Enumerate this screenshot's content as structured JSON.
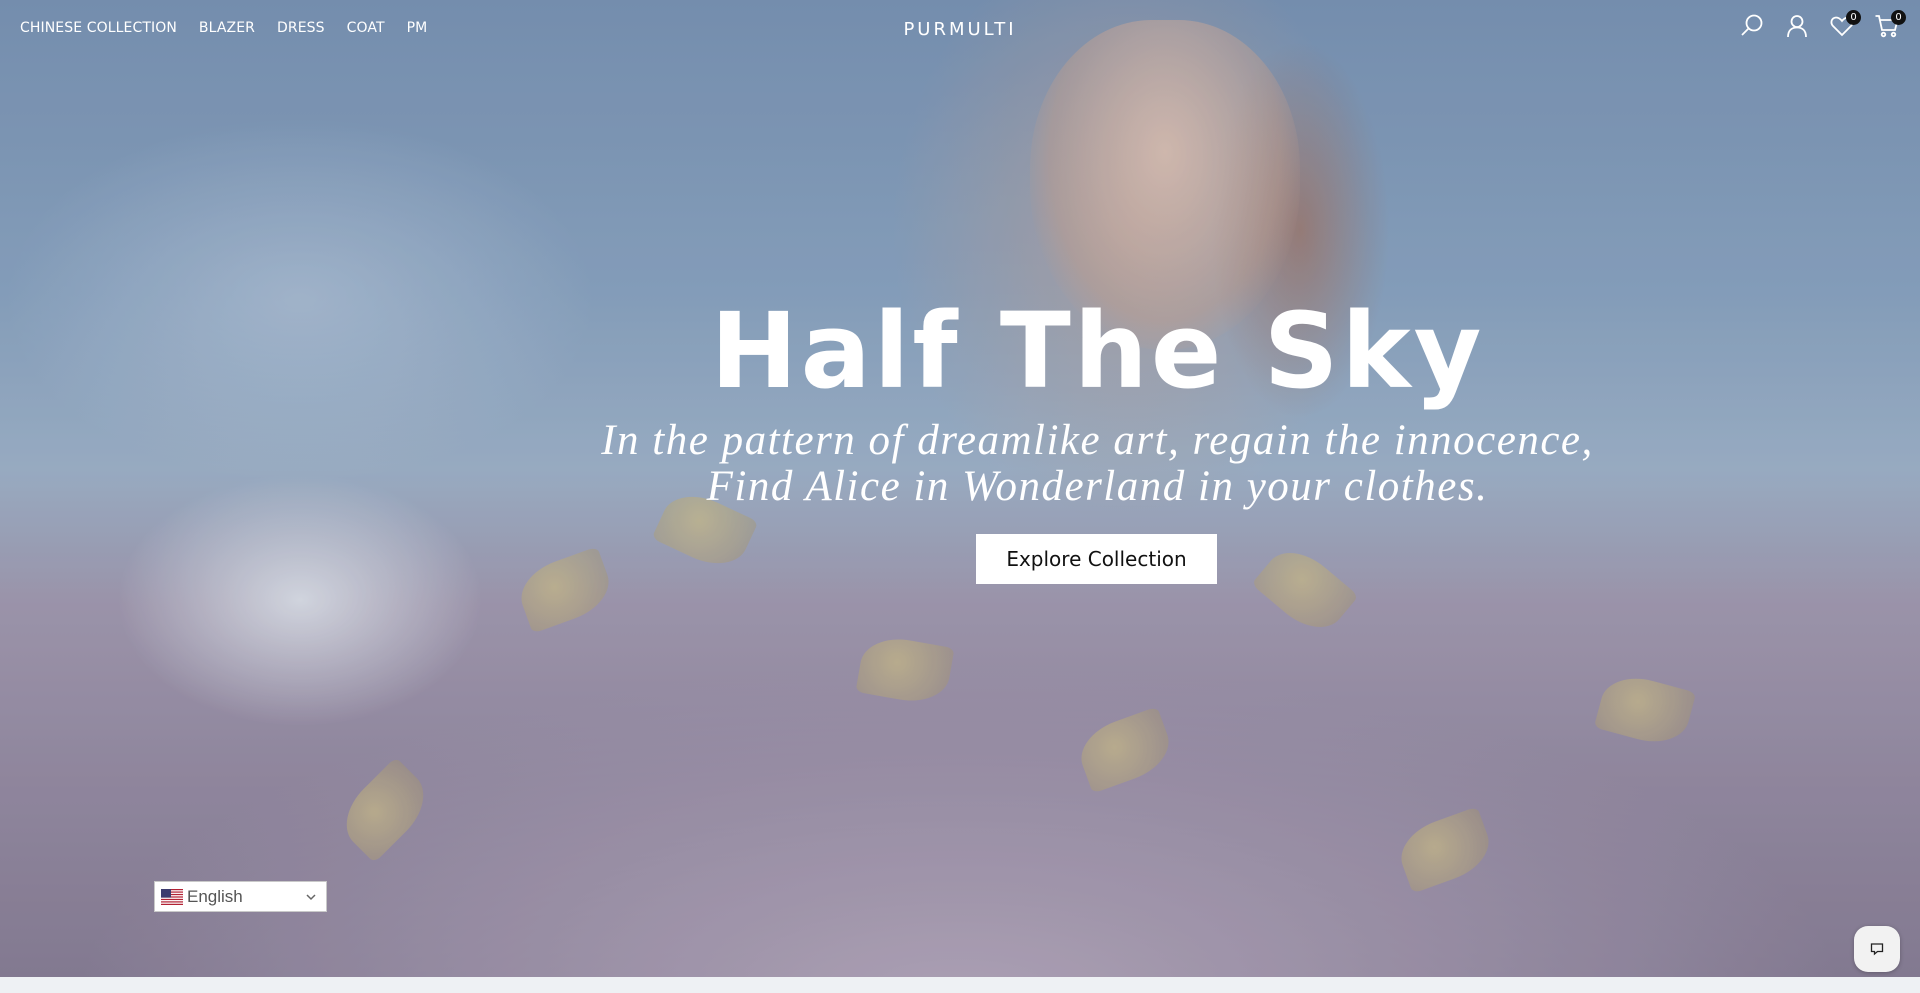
{
  "nav": {
    "menu": [
      {
        "label": "CHINESE COLLECTION"
      },
      {
        "label": "BLAZER"
      },
      {
        "label": "DRESS"
      },
      {
        "label": "COAT"
      },
      {
        "label": "PM"
      }
    ],
    "logo": "PURMULTI",
    "icons": {
      "search": "search-icon",
      "account": "user-icon",
      "wishlist": "heart-icon",
      "cart": "cart-icon"
    },
    "wishlist_count": "0",
    "cart_count": "0"
  },
  "hero": {
    "title": "Half The Sky",
    "subtitle_line1": "In the pattern of dreamlike art, regain the innocence,",
    "subtitle_line2": "Find Alice in Wonderland in your clothes.",
    "cta_label": "Explore Collection"
  },
  "language": {
    "selected": "English",
    "flag": "us-flag-icon"
  },
  "chat": {
    "icon": "chat-bubble-icon"
  },
  "colors": {
    "text_light": "#ffffff",
    "button_bg": "#ffffff",
    "button_text": "#111111",
    "badge_bg": "#111111"
  }
}
